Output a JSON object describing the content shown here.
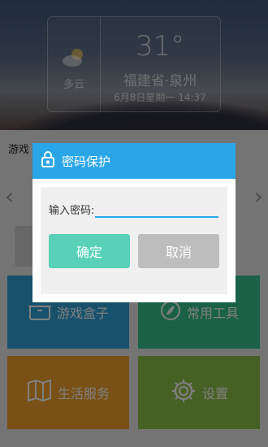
{
  "weather": {
    "condition": "多云",
    "temperature": "31°",
    "location": "福建省·泉州",
    "datetime": "6月8日星期一 14:37",
    "icon": "partly-cloudy-icon"
  },
  "main": {
    "section_label": "游戏",
    "tiles": [
      {
        "label": "游戏盒子",
        "icon": "box-icon",
        "color": "#2ea3d8"
      },
      {
        "label": "常用工具",
        "icon": "compass-icon",
        "color": "#35c28f"
      },
      {
        "label": "生活服务",
        "icon": "map-icon",
        "color": "#f2a12c"
      },
      {
        "label": "设置",
        "icon": "gear-icon",
        "color": "#8fc34a"
      }
    ]
  },
  "dialog": {
    "title": "密码保护",
    "password_label": "输入密码:",
    "password_value": "",
    "confirm_label": "确定",
    "cancel_label": "取消",
    "header_color": "#2aa6e8"
  }
}
